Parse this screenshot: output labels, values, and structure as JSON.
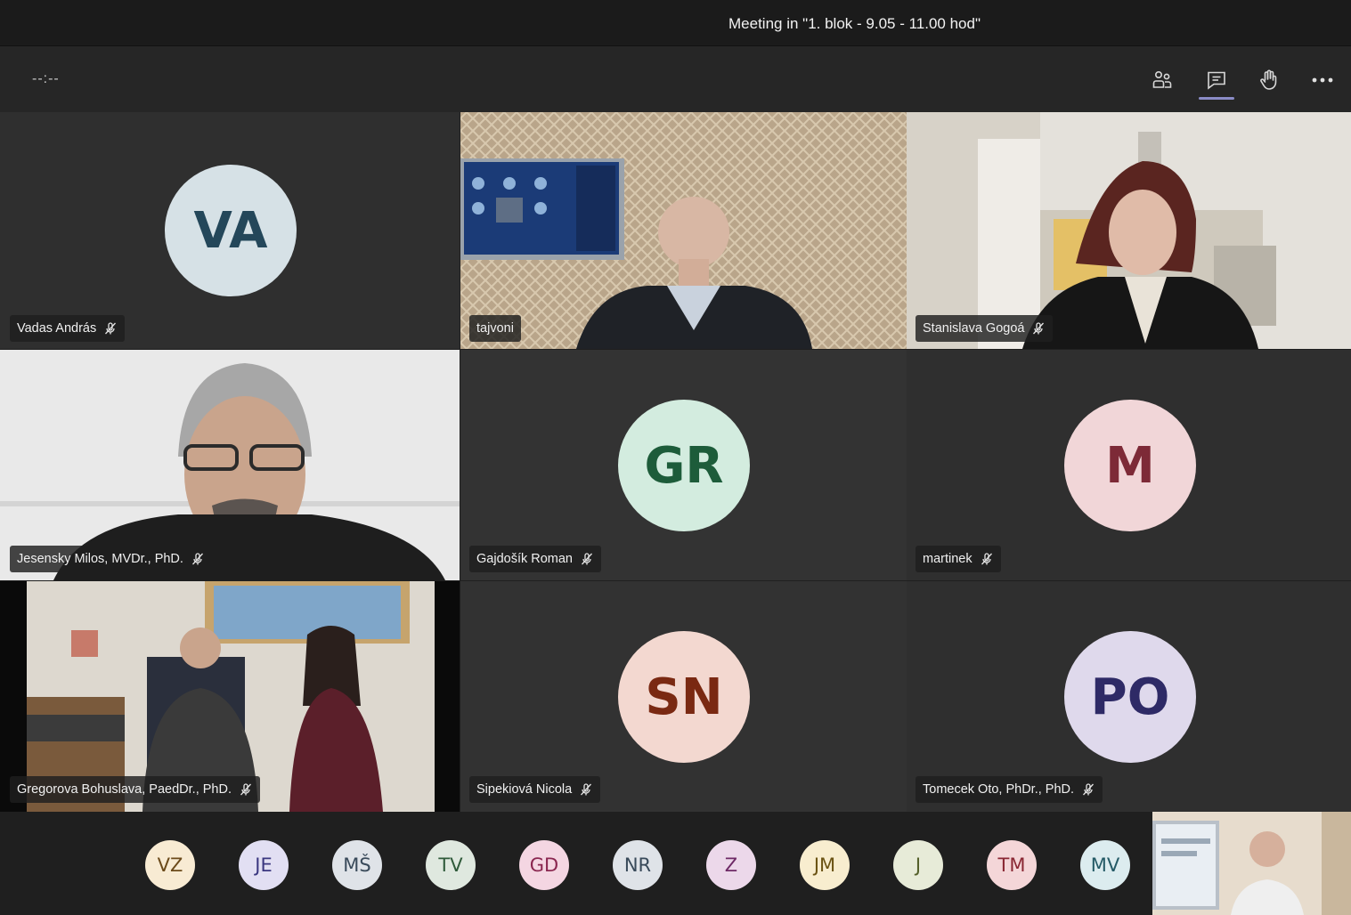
{
  "window": {
    "title": "Meeting in \"1. blok - 9.05 - 11.00 hod\""
  },
  "toolbar": {
    "timer": "--:--",
    "buttons": [
      {
        "name": "participants-icon"
      },
      {
        "name": "chat-icon",
        "active": true
      },
      {
        "name": "raise-hand-icon"
      },
      {
        "name": "more-options-icon"
      }
    ]
  },
  "accent": "#8b8cc7",
  "tiles": [
    {
      "name": "Vadas András",
      "initials": "VA",
      "muted": true,
      "video": false,
      "avatar_bg": "#d6e1e6",
      "avatar_fg": "#24475a"
    },
    {
      "name": "tajvoni",
      "muted": false,
      "video": true
    },
    {
      "name": "Stanislava Gogoá",
      "muted": true,
      "video": true
    },
    {
      "name": "Jesensky Milos, MVDr., PhD.",
      "muted": true,
      "video": true
    },
    {
      "name": "Gajdošík Roman",
      "initials": "GR",
      "muted": true,
      "video": false,
      "avatar_bg": "#d3ecdf",
      "avatar_fg": "#1d5c3a"
    },
    {
      "name": "martinek",
      "initials": "M",
      "muted": true,
      "video": false,
      "avatar_bg": "#f1d6d8",
      "avatar_fg": "#7d2a37"
    },
    {
      "name": "Gregorova Bohuslava, PaedDr., PhD.",
      "muted": true,
      "video": true
    },
    {
      "name": "Sipekiová Nicola",
      "initials": "SN",
      "muted": true,
      "video": false,
      "avatar_bg": "#f3d8d0",
      "avatar_fg": "#7a2912"
    },
    {
      "name": "Tomecek Oto, PhDr., PhD.",
      "initials": "PO",
      "muted": true,
      "video": false,
      "avatar_bg": "#dfd9ec",
      "avatar_fg": "#2e2a66"
    }
  ],
  "overflow_participants": [
    {
      "initials": "VZ",
      "bg": "#f8ebd3",
      "fg": "#6b4a1a"
    },
    {
      "initials": "JE",
      "bg": "#e2dff3",
      "fg": "#3b3780"
    },
    {
      "initials": "MŠ",
      "bg": "#dfe3e8",
      "fg": "#394a5a"
    },
    {
      "initials": "TV",
      "bg": "#dfe8df",
      "fg": "#2f5a3a"
    },
    {
      "initials": "GD",
      "bg": "#f4d6e2",
      "fg": "#8a2750"
    },
    {
      "initials": "NR",
      "bg": "#dfe3e8",
      "fg": "#394a5a"
    },
    {
      "initials": "Z",
      "bg": "#ecd8ea",
      "fg": "#6e2a66"
    },
    {
      "initials": "JM",
      "bg": "#f8edcf",
      "fg": "#6b5314"
    },
    {
      "initials": "J",
      "bg": "#e7ebd8",
      "fg": "#54602a"
    },
    {
      "initials": "TM",
      "bg": "#f4d6d8",
      "fg": "#8a2733"
    },
    {
      "initials": "MV",
      "bg": "#dcecef",
      "fg": "#245a66"
    }
  ]
}
